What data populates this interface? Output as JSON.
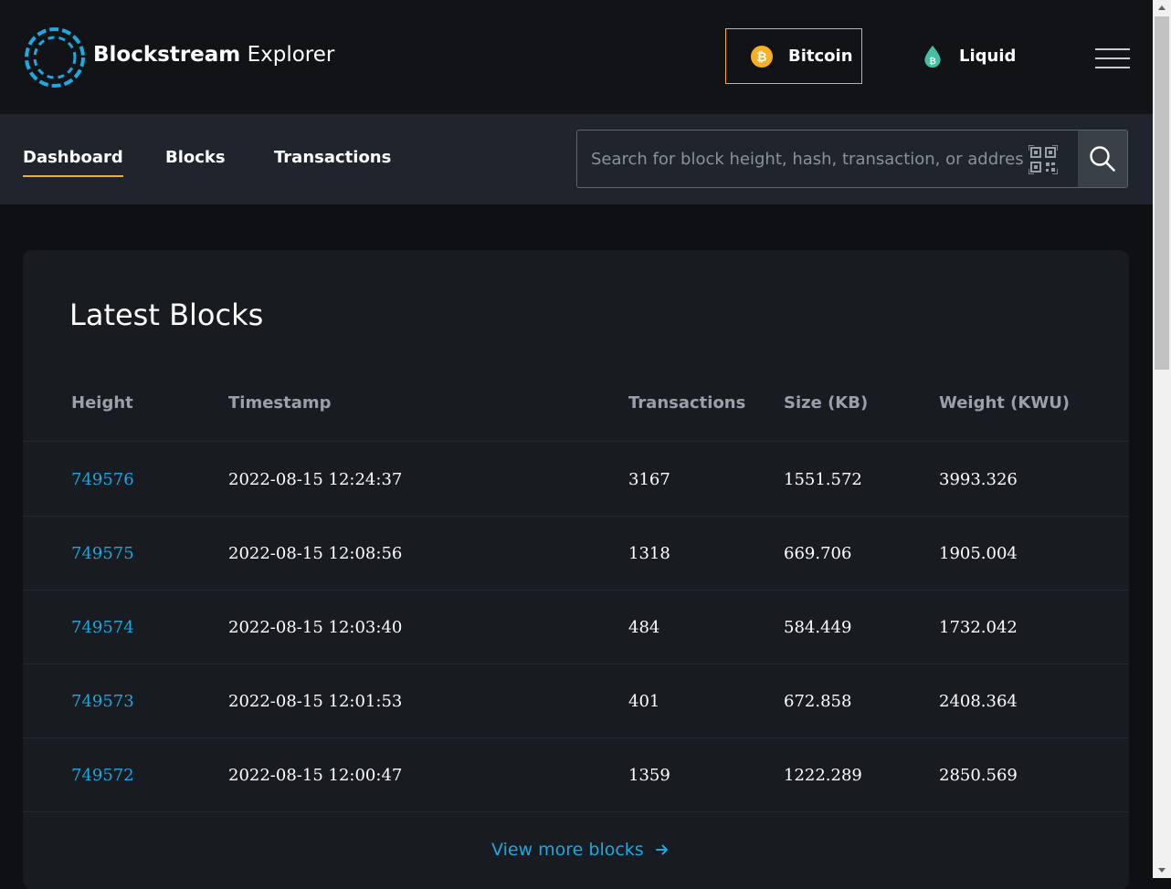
{
  "header": {
    "brand_bold": "Blockstream",
    "brand_light": "Explorer",
    "networks": [
      {
        "label": "Bitcoin",
        "icon": "bitcoin-icon",
        "active": true
      },
      {
        "label": "Liquid",
        "icon": "liquid-icon",
        "active": false
      }
    ],
    "menu_icon": "hamburger-menu-icon"
  },
  "nav": {
    "tabs": [
      {
        "label": "Dashboard",
        "active": true
      },
      {
        "label": "Blocks",
        "active": false
      },
      {
        "label": "Transactions",
        "active": false
      }
    ]
  },
  "search": {
    "placeholder": "Search for block height, hash, transaction, or address",
    "value": ""
  },
  "latest_blocks": {
    "title": "Latest Blocks",
    "columns": [
      "Height",
      "Timestamp",
      "Transactions",
      "Size (KB)",
      "Weight (KWU)"
    ],
    "rows": [
      [
        "749576",
        "2022-08-15 12:24:37",
        "3167",
        "1551.572",
        "3993.326"
      ],
      [
        "749575",
        "2022-08-15 12:08:56",
        "1318",
        "669.706",
        "1905.004"
      ],
      [
        "749574",
        "2022-08-15 12:03:40",
        "484",
        "584.449",
        "1732.042"
      ],
      [
        "749573",
        "2022-08-15 12:01:53",
        "401",
        "672.858",
        "2408.364"
      ],
      [
        "749572",
        "2022-08-15 12:00:47",
        "1359",
        "1222.289",
        "2850.569"
      ]
    ],
    "view_more": "View more blocks"
  },
  "colors": {
    "accent_orange": "#f7b023",
    "link_blue": "#1ea7e0",
    "liquid_teal": "#46bea4"
  }
}
